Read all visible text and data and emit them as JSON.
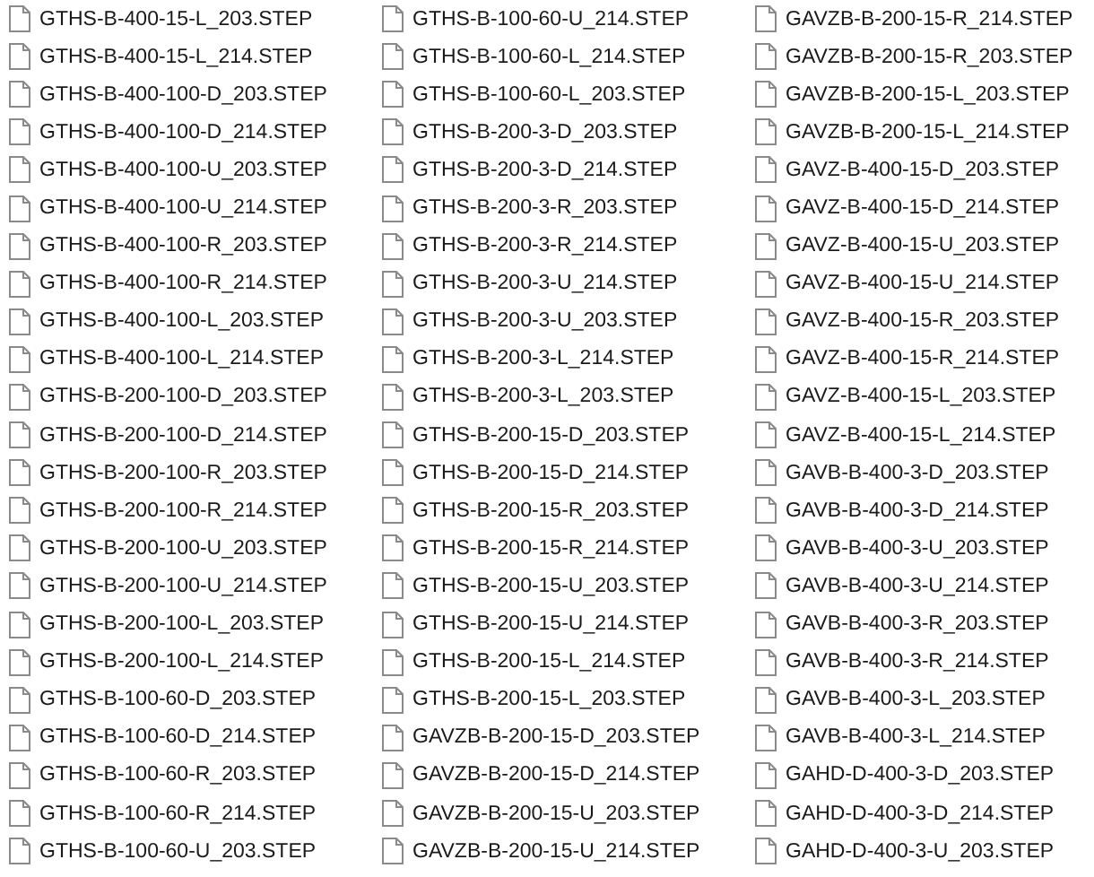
{
  "columns": [
    [
      "GTHS-B-400-15-L_203.STEP",
      "GTHS-B-400-15-L_214.STEP",
      "GTHS-B-400-100-D_203.STEP",
      "GTHS-B-400-100-D_214.STEP",
      "GTHS-B-400-100-U_203.STEP",
      "GTHS-B-400-100-U_214.STEP",
      "GTHS-B-400-100-R_203.STEP",
      "GTHS-B-400-100-R_214.STEP",
      "GTHS-B-400-100-L_203.STEP",
      "GTHS-B-400-100-L_214.STEP",
      "GTHS-B-200-100-D_203.STEP",
      "GTHS-B-200-100-D_214.STEP",
      "GTHS-B-200-100-R_203.STEP",
      "GTHS-B-200-100-R_214.STEP",
      "GTHS-B-200-100-U_203.STEP",
      "GTHS-B-200-100-U_214.STEP",
      "GTHS-B-200-100-L_203.STEP",
      "GTHS-B-200-100-L_214.STEP",
      "GTHS-B-100-60-D_203.STEP",
      "GTHS-B-100-60-D_214.STEP",
      "GTHS-B-100-60-R_203.STEP",
      "GTHS-B-100-60-R_214.STEP",
      "GTHS-B-100-60-U_203.STEP"
    ],
    [
      "GTHS-B-100-60-U_214.STEP",
      "GTHS-B-100-60-L_214.STEP",
      "GTHS-B-100-60-L_203.STEP",
      "GTHS-B-200-3-D_203.STEP",
      "GTHS-B-200-3-D_214.STEP",
      "GTHS-B-200-3-R_203.STEP",
      "GTHS-B-200-3-R_214.STEP",
      "GTHS-B-200-3-U_214.STEP",
      "GTHS-B-200-3-U_203.STEP",
      "GTHS-B-200-3-L_214.STEP",
      "GTHS-B-200-3-L_203.STEP",
      "GTHS-B-200-15-D_203.STEP",
      "GTHS-B-200-15-D_214.STEP",
      "GTHS-B-200-15-R_203.STEP",
      "GTHS-B-200-15-R_214.STEP",
      "GTHS-B-200-15-U_203.STEP",
      "GTHS-B-200-15-U_214.STEP",
      "GTHS-B-200-15-L_214.STEP",
      "GTHS-B-200-15-L_203.STEP",
      "GAVZB-B-200-15-D_203.STEP",
      "GAVZB-B-200-15-D_214.STEP",
      "GAVZB-B-200-15-U_203.STEP",
      "GAVZB-B-200-15-U_214.STEP"
    ],
    [
      "GAVZB-B-200-15-R_214.STEP",
      "GAVZB-B-200-15-R_203.STEP",
      "GAVZB-B-200-15-L_203.STEP",
      "GAVZB-B-200-15-L_214.STEP",
      "GAVZ-B-400-15-D_203.STEP",
      "GAVZ-B-400-15-D_214.STEP",
      "GAVZ-B-400-15-U_203.STEP",
      "GAVZ-B-400-15-U_214.STEP",
      "GAVZ-B-400-15-R_203.STEP",
      "GAVZ-B-400-15-R_214.STEP",
      "GAVZ-B-400-15-L_203.STEP",
      "GAVZ-B-400-15-L_214.STEP",
      "GAVB-B-400-3-D_203.STEP",
      "GAVB-B-400-3-D_214.STEP",
      "GAVB-B-400-3-U_203.STEP",
      "GAVB-B-400-3-U_214.STEP",
      "GAVB-B-400-3-R_203.STEP",
      "GAVB-B-400-3-R_214.STEP",
      "GAVB-B-400-3-L_203.STEP",
      "GAVB-B-400-3-L_214.STEP",
      "GAHD-D-400-3-D_203.STEP",
      "GAHD-D-400-3-D_214.STEP",
      "GAHD-D-400-3-U_203.STEP"
    ]
  ]
}
